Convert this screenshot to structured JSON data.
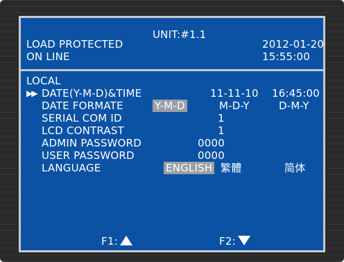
{
  "header": {
    "status_line1": "LOAD PROTECTED",
    "status_line2": "ON LINE",
    "unit": "UNIT:#1.1",
    "date": "2012-01-20",
    "time": "15:55:00"
  },
  "menu": {
    "title": "LOCAL",
    "cursor": "▶▶",
    "date_time": {
      "label": "DATE(Y-M-D)&TIME",
      "date": "11-11-10",
      "time": "16:45:00"
    },
    "date_format": {
      "label": "DATE FORMATE",
      "options": [
        "Y-M-D",
        "M-D-Y",
        "D-M-Y"
      ],
      "selected": "Y-M-D"
    },
    "serial_com_id": {
      "label": "SERIAL COM ID",
      "value": "1"
    },
    "lcd_contrast": {
      "label": "LCD CONTRAST",
      "value": "1"
    },
    "admin_password": {
      "label": "ADMIN PASSWORD",
      "value": "0000"
    },
    "user_password": {
      "label": "USER PASSWORD",
      "value": "0000"
    },
    "language": {
      "label": "LANGUAGE",
      "options": [
        "ENGLISH",
        "繁體",
        "简体"
      ],
      "selected": "ENGLISH"
    }
  },
  "footer": {
    "f1_label": "F1:",
    "f1_icon": "up-triangle-icon",
    "f2_label": "F2:",
    "f2_icon": "down-triangle-icon"
  },
  "colors": {
    "screen_bg": "#0b52a4",
    "text": "#ffffff",
    "highlight": "#9aa0a6",
    "frame": "#c8ccd2",
    "bezel": "#2a2a2a"
  }
}
